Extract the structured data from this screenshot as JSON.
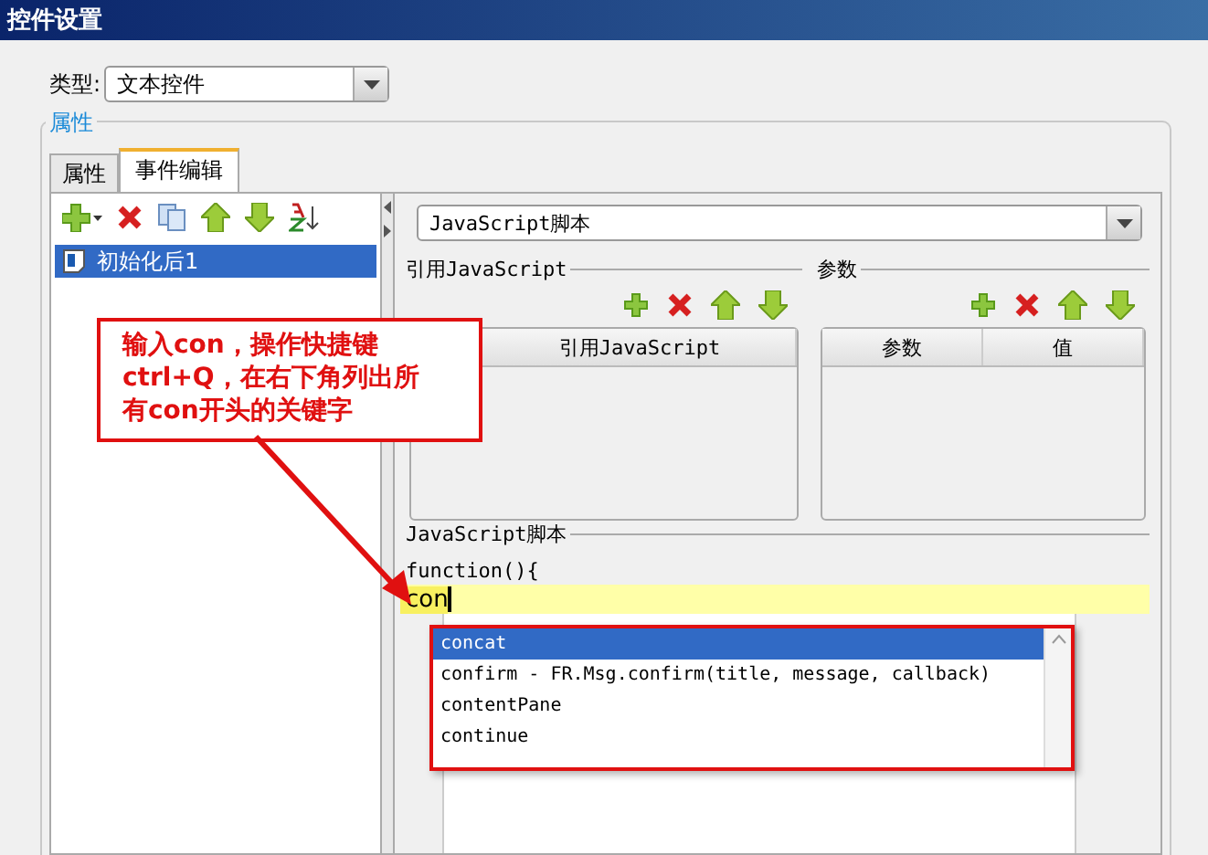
{
  "window": {
    "title": "控件设置"
  },
  "type_field": {
    "label": "类型:",
    "value": "文本控件"
  },
  "group": {
    "title": "属性"
  },
  "tabs": [
    {
      "label": "属性",
      "selected": false
    },
    {
      "label": "事件编辑",
      "selected": true
    }
  ],
  "events": [
    {
      "label": "初始化后1",
      "selected": true
    }
  ],
  "script_type": {
    "value": "JavaScript脚本"
  },
  "ref_section": {
    "title": "引用JavaScript",
    "columns": [
      "引用JavaScript"
    ]
  },
  "param_section": {
    "title": "参数",
    "columns": [
      "参数",
      "值"
    ]
  },
  "script_section": {
    "title": "JavaScript脚本",
    "first_line": "function(){",
    "typed": "con"
  },
  "autocomplete": [
    {
      "label": "concat",
      "selected": true
    },
    {
      "label": "confirm - FR.Msg.confirm(title, message, callback)",
      "selected": false
    },
    {
      "label": "contentPane",
      "selected": false
    },
    {
      "label": "continue",
      "selected": false
    }
  ],
  "callout": {
    "text": "输入con，操作快捷键ctrl+Q，在右下角列出所有con开头的关键字"
  }
}
